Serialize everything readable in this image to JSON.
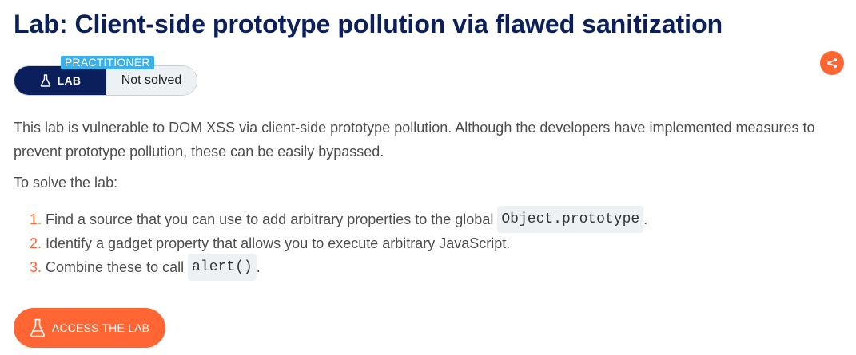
{
  "page": {
    "title": "Lab: Client-side prototype pollution via flawed sanitization"
  },
  "lab_status": {
    "level": "PRACTITIONER",
    "type_label": "LAB",
    "status": "Not solved"
  },
  "share": {
    "icon": "share-icon"
  },
  "description": "This lab is vulnerable to DOM XSS via client-side prototype pollution. Although the developers have implemented measures to prevent prototype pollution, these can be easily bypassed.",
  "solve_intro": "To solve the lab:",
  "steps": [
    {
      "num": "1.",
      "text": "Find a source that you can use to add arbitrary properties to the global ",
      "code": "Object.prototype",
      "suffix": "."
    },
    {
      "num": "2.",
      "text": "Identify a gadget property that allows you to execute arbitrary JavaScript.",
      "code": "",
      "suffix": ""
    },
    {
      "num": "3.",
      "text": "Combine these to call ",
      "code": "alert()",
      "suffix": "."
    }
  ],
  "access_button": {
    "label": "ACCESS THE LAB",
    "icon": "flask-icon"
  },
  "colors": {
    "title": "#0a1f5c",
    "accent": "#ff6633",
    "badge": "#3bb0ea",
    "lab_pill": "#0a1f5c"
  }
}
